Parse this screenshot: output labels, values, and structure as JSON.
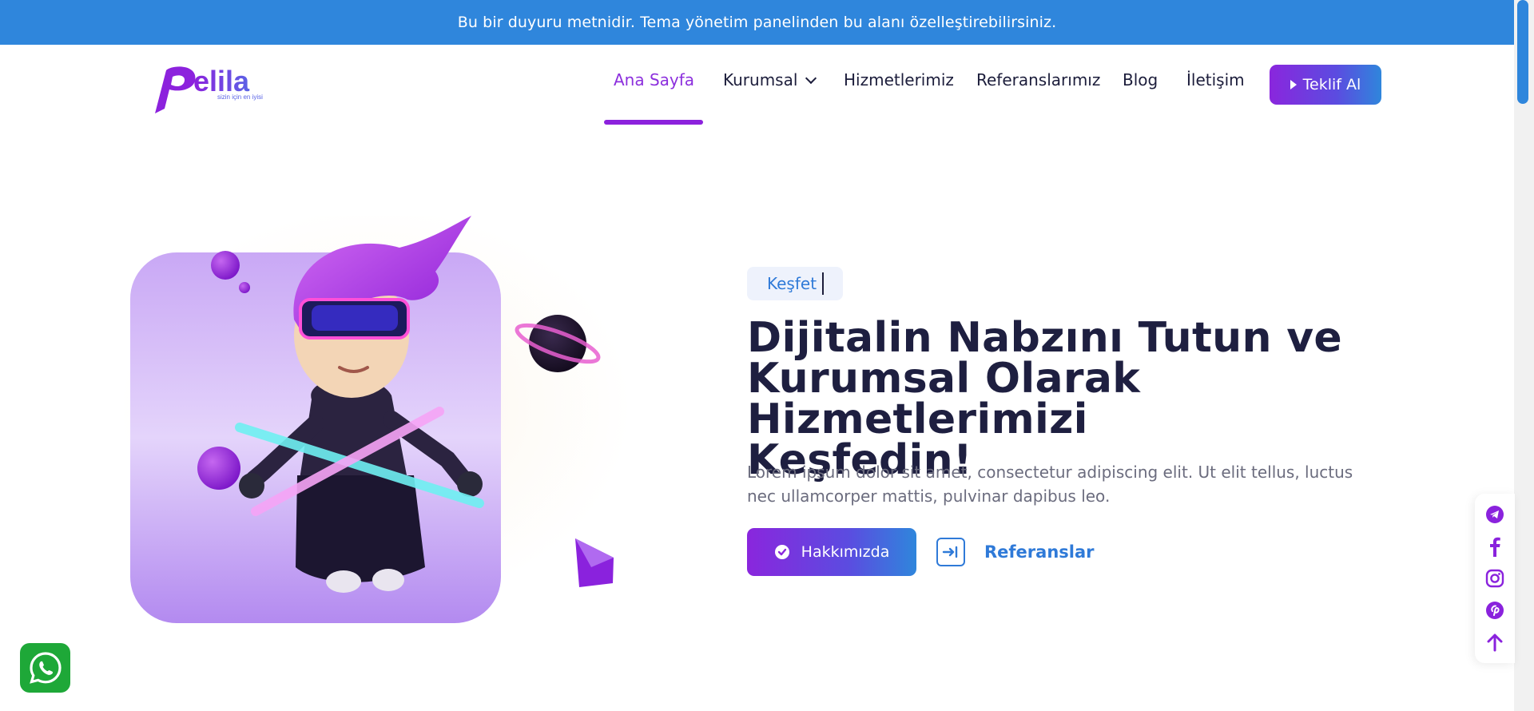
{
  "announcement": {
    "text": "Bu bir duyuru metnidir. Tema yönetim panelinden bu alanı özelleştirebilirsiniz."
  },
  "logo": {
    "wordmark": "pelila",
    "tagline": "sizin için en iyisi"
  },
  "nav": {
    "items": [
      {
        "label": "Ana Sayfa",
        "active": true
      },
      {
        "label": "Kurumsal",
        "has_dropdown": true
      },
      {
        "label": "Hizmetlerimiz"
      },
      {
        "label": "Referanslarımız"
      },
      {
        "label": "Blog"
      },
      {
        "label": "İletişim"
      }
    ],
    "cta_label": "Teklif Al"
  },
  "hero": {
    "tag": "Keşfet",
    "headline_lines": [
      "Dijitalin Nabzını Tutun ve",
      "Kurumsal Olarak Hizmetlerimizi",
      "Keşfedin!"
    ],
    "lead": "Lorem ipsum dolor sit amet, consectetur adipiscing elit. Ut elit tellus, luctus nec ullamcorper mattis, pulvinar dapibus leo.",
    "primary_button": "Hakkımızda",
    "secondary_link": "Referanslar"
  },
  "social_icons": [
    "telegram-icon",
    "facebook-icon",
    "instagram-icon",
    "pinterest-icon",
    "arrow-up-icon"
  ],
  "colors": {
    "primary_purple": "#8c22dd",
    "primary_blue": "#2f86dc",
    "dark_text": "#1e1f40",
    "whatsapp_green": "#1ea838"
  }
}
